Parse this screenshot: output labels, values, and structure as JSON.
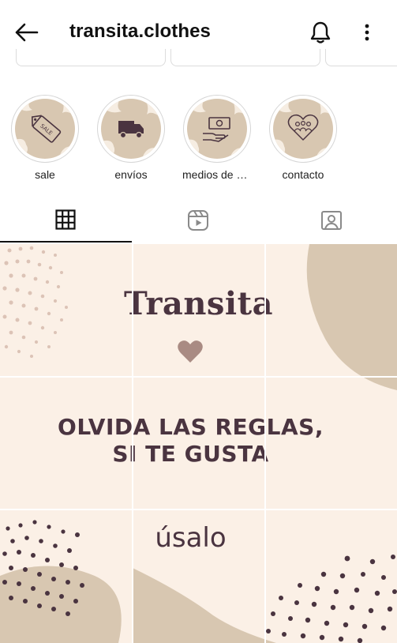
{
  "header": {
    "title": "transita.clothes",
    "back_icon": "arrow-left-icon",
    "bell_icon": "bell-icon",
    "more_icon": "more-vertical-icon"
  },
  "highlights": [
    {
      "label": "sale",
      "icon": "sale-tag-icon"
    },
    {
      "label": "envíos",
      "icon": "truck-icon"
    },
    {
      "label": "medios de pa…",
      "icon": "money-hand-icon"
    },
    {
      "label": "contacto",
      "icon": "people-heart-icon"
    }
  ],
  "tabs": [
    {
      "name": "grid",
      "icon": "grid-icon",
      "active": true
    },
    {
      "name": "reels",
      "icon": "reels-icon",
      "active": false
    },
    {
      "name": "tagged",
      "icon": "tagged-user-icon",
      "active": false
    }
  ],
  "posts": {
    "brand": "Transita",
    "slogan_line1": "OLVIDA LAS REGLAS,",
    "slogan_line2": "SI TE GUSTA",
    "closing": "úsalo",
    "heart_icon": "heart-icon"
  },
  "colors": {
    "post_background": "#fbf0e6",
    "post_accent": "#d8c7b1",
    "post_text": "#4a3440",
    "heart": "#a98b83"
  }
}
